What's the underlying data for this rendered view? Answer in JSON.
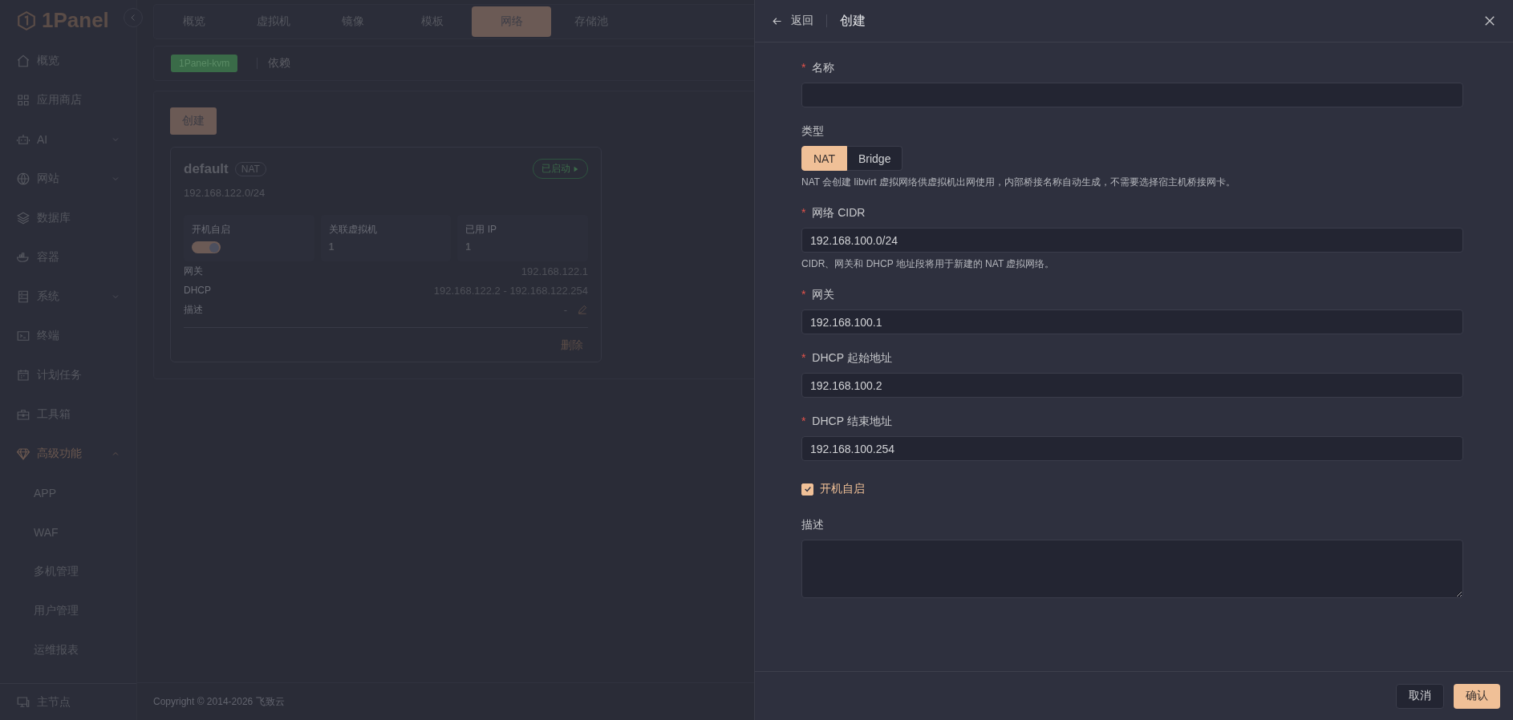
{
  "sidebar": {
    "logo": "1Panel",
    "items": [
      {
        "label": "概览",
        "selected": false
      },
      {
        "label": "应用商店",
        "selected": false
      },
      {
        "label": "AI",
        "selected": false,
        "expanded": false
      },
      {
        "label": "网站",
        "selected": false,
        "expanded": false
      },
      {
        "label": "数据库",
        "selected": false
      },
      {
        "label": "容器",
        "selected": false
      },
      {
        "label": "系统",
        "selected": false,
        "expanded": false
      },
      {
        "label": "终端",
        "selected": false
      },
      {
        "label": "计划任务",
        "selected": false
      },
      {
        "label": "工具箱",
        "selected": false
      },
      {
        "label": "高级功能",
        "selected": true,
        "expanded": true,
        "children": [
          {
            "label": "APP",
            "selected": false
          },
          {
            "label": "WAF",
            "selected": false
          },
          {
            "label": "多机管理",
            "selected": false
          },
          {
            "label": "用户管理",
            "selected": false
          },
          {
            "label": "运维报表",
            "selected": false
          }
        ]
      }
    ],
    "node": "主节点"
  },
  "tabs": [
    {
      "label": "概览",
      "selected": false
    },
    {
      "label": "虚拟机",
      "selected": false
    },
    {
      "label": "镜像",
      "selected": false
    },
    {
      "label": "模板",
      "selected": false
    },
    {
      "label": "网络",
      "selected": true
    },
    {
      "label": "存储池",
      "selected": false
    }
  ],
  "subbar": {
    "tag": "1Panel-kvm",
    "link": "依赖"
  },
  "create_button": "创建",
  "network_card": {
    "name": "default",
    "type": "NAT",
    "status": "已启动",
    "cidr": "192.168.122.0/24",
    "stats": [
      {
        "kind": "toggle",
        "label": "开机自启",
        "on": true
      },
      {
        "kind": "value",
        "label": "关联虚拟机",
        "value": "1"
      },
      {
        "kind": "value",
        "label": "已用 IP",
        "value": "1"
      }
    ],
    "details": [
      {
        "label": "网关",
        "value": "192.168.122.1"
      },
      {
        "label": "DHCP",
        "value": "192.168.122.2 - 192.168.122.254"
      },
      {
        "label": "描述",
        "value": "-",
        "editable": true
      }
    ],
    "delete": "删除"
  },
  "footer": "Copyright © 2014-2026 飞致云",
  "drawer": {
    "back": "返回",
    "title": "创建",
    "fields": [
      {
        "kind": "input",
        "label": "名称",
        "required_mark": "*"
      },
      {
        "kind": "segmented",
        "label": "类型",
        "options": [
          {
            "label": "NAT",
            "selected": true
          },
          {
            "label": "Bridge",
            "selected": false
          }
        ],
        "hint": "NAT 会创建 libvirt 虚拟网络供虚拟机出网使用，内部桥接名称自动生成，不需要选择宿主机桥接网卡。"
      },
      {
        "kind": "input",
        "label": "网络 CIDR",
        "required_mark": "*",
        "value": "192.168.100.0/24",
        "hint": "CIDR、网关和 DHCP 地址段将用于新建的 NAT 虚拟网络。"
      },
      {
        "kind": "input",
        "label": "网关",
        "required_mark": "*",
        "value": "192.168.100.1"
      },
      {
        "kind": "input",
        "label": "DHCP 起始地址",
        "required_mark": "*",
        "value": "192.168.100.2"
      },
      {
        "kind": "input",
        "label": "DHCP 结束地址",
        "required_mark": "*",
        "value": "192.168.100.254"
      },
      {
        "kind": "checkbox",
        "label": "开机自启",
        "checked": true
      },
      {
        "kind": "textarea",
        "label": "描述"
      }
    ],
    "cancel": "取消",
    "confirm": "确认"
  }
}
